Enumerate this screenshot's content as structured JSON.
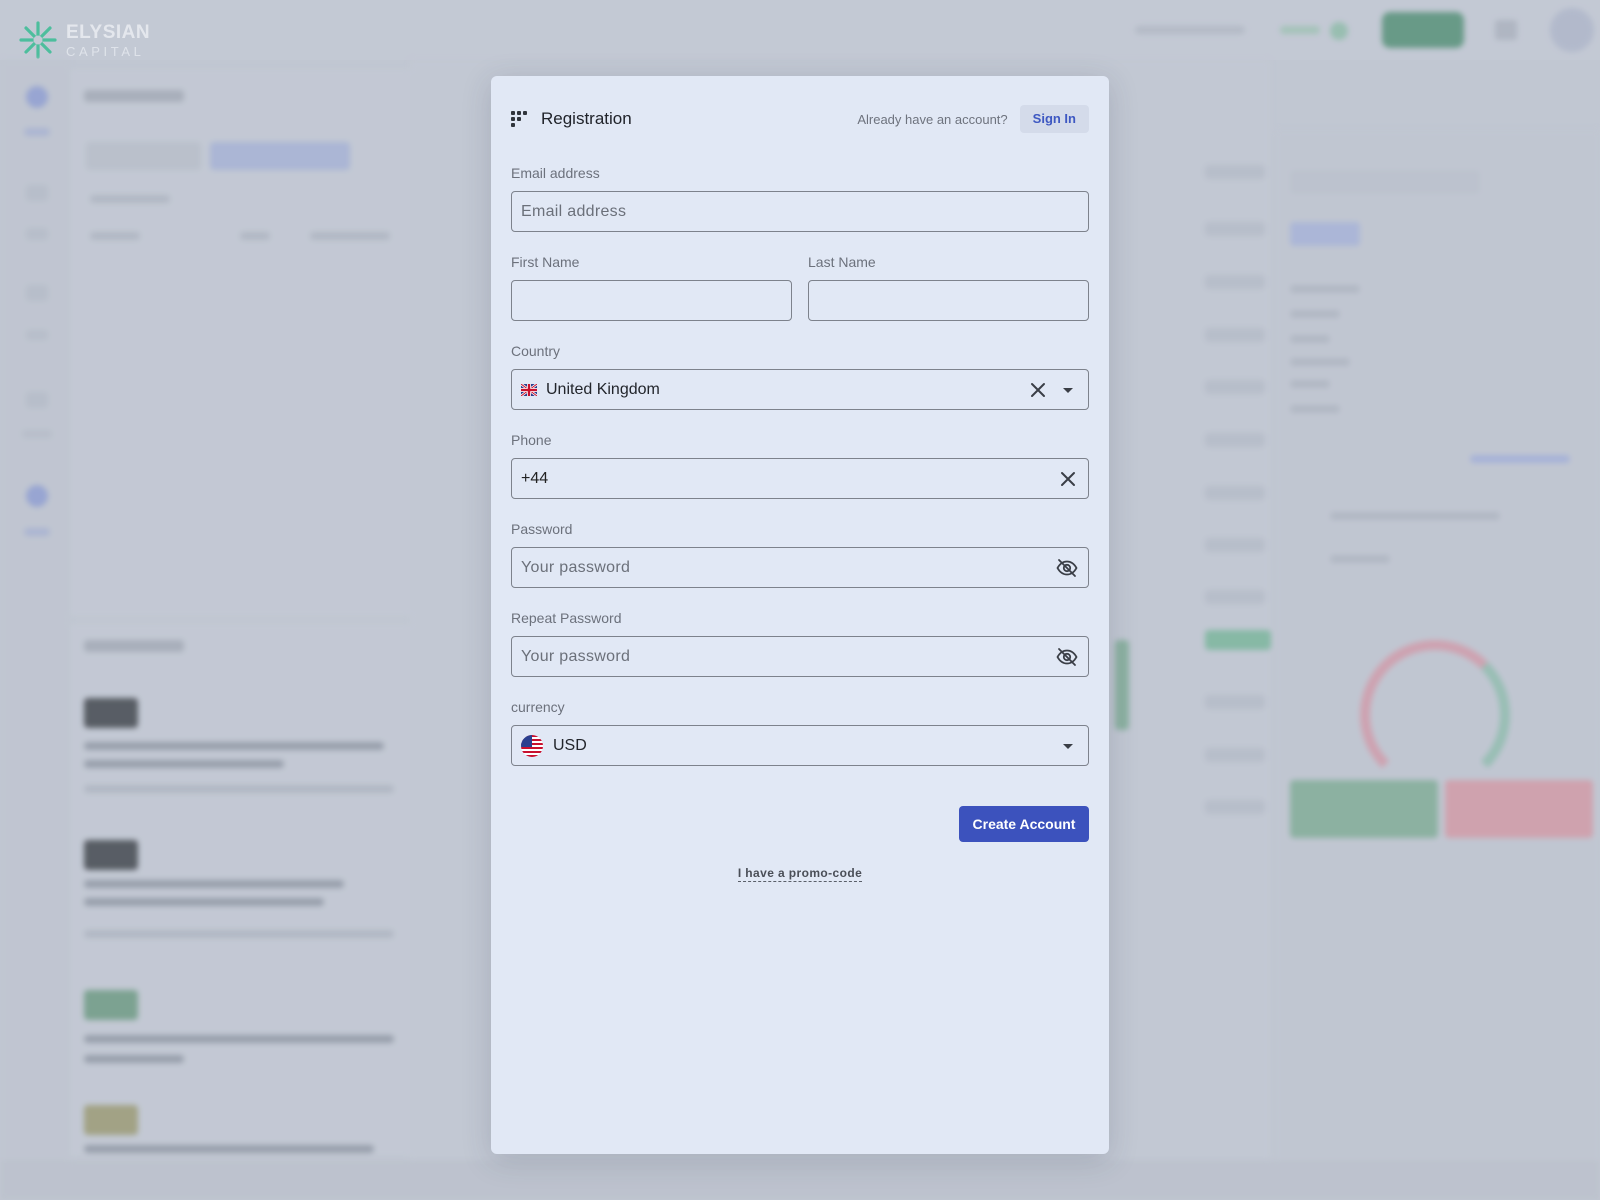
{
  "brand": {
    "name": "ELYSIAN",
    "sub": "CAPITAL"
  },
  "modal": {
    "title": "Registration",
    "already_text": "Already have an account?",
    "signin_label": "Sign In",
    "email": {
      "label": "Email address",
      "placeholder": "Email address",
      "value": ""
    },
    "first_name": {
      "label": "First Name",
      "value": ""
    },
    "last_name": {
      "label": "Last Name",
      "value": ""
    },
    "country": {
      "label": "Country",
      "value": "United Kingdom",
      "flag": "gb-flag-icon"
    },
    "phone": {
      "label": "Phone",
      "value": "+44"
    },
    "password": {
      "label": "Password",
      "placeholder": "Your password"
    },
    "repeat_password": {
      "label": "Repeat Password",
      "placeholder": "Your password"
    },
    "currency": {
      "label": "currency",
      "value": "USD",
      "flag": "us-flag-icon"
    },
    "create_label": "Create Account",
    "promo_label": "I have a promo-code"
  },
  "colors": {
    "modal_bg": "#e1e8f5",
    "primary": "#3c52bd",
    "signin_text": "#3e58c2",
    "brand_teal": "#2bbf8f"
  }
}
